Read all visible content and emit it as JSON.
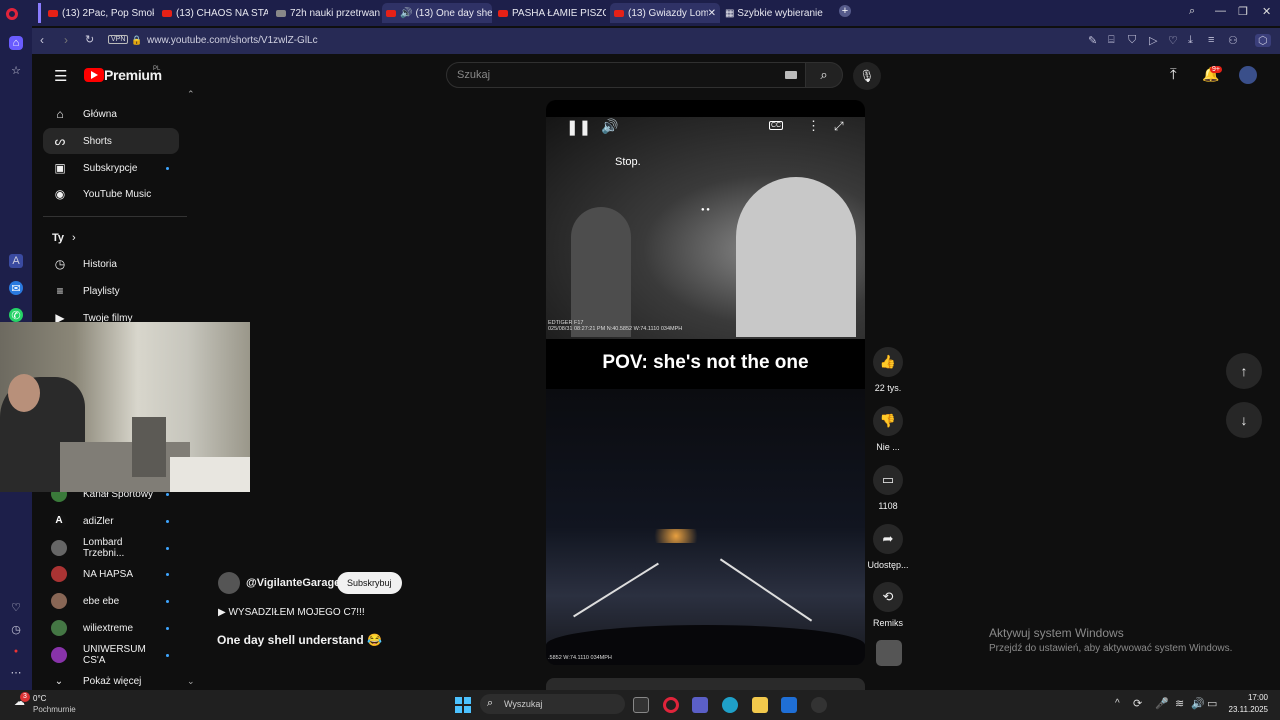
{
  "browser": {
    "tabs": [
      {
        "label": "(13) 2Pac, Pop Smoke - W",
        "active": false
      },
      {
        "label": "(13) CHAOS NA STARCIE,",
        "active": false
      },
      {
        "label": "72h nauki przetrwania - c",
        "active": false
      },
      {
        "label": "(13) One day shell und",
        "active": true
      },
      {
        "label": "PASHA ŁAMIE PISZCZEL!",
        "active": false
      },
      {
        "label": "(13) Gwiazdy Lombard",
        "active": true
      }
    ],
    "speed_dial": "Szybkie wybieranie",
    "url": "www.youtube.com/shorts/V1zwlZ-GlLc",
    "vpn": "VPN"
  },
  "youtube": {
    "logo_text": "Premium",
    "logo_sup": "PL",
    "search_placeholder": "Szukaj",
    "notif_badge": "9+",
    "nav": [
      {
        "label": "Główna",
        "icon": "home-icon"
      },
      {
        "label": "Shorts",
        "icon": "shorts-icon",
        "active": true
      },
      {
        "label": "Subskrypcje",
        "icon": "subscriptions-icon"
      },
      {
        "label": "YouTube Music",
        "icon": "music-icon"
      }
    ],
    "you_section": "Ty",
    "you_items": [
      {
        "label": "Historia"
      },
      {
        "label": "Playlisty"
      },
      {
        "label": "Twoje filmy"
      }
    ],
    "channels": [
      {
        "label": "Kanał Sportowy",
        "color": "#3a7a3a"
      },
      {
        "label": "adiZler",
        "color": "#111111"
      },
      {
        "label": "Lombard Trzebni...",
        "color": "#666666"
      },
      {
        "label": "NA HAPSA",
        "color": "#aa3333"
      },
      {
        "label": "ebe ebe",
        "color": "#886655"
      },
      {
        "label": "wiliextreme",
        "color": "#447744"
      },
      {
        "label": "UNIWERSUM CS'A",
        "color": "#8833aa"
      }
    ],
    "show_more": "Pokaż więcej",
    "short": {
      "subtitle": "Stop.",
      "dashcam_top": "EDTIGER F17\n025/08/31 08:27:21 PM N:40.5852 W:74.1110 034MPH",
      "dashcam_bottom": ".5852 W:74.1110 034MPH",
      "caption": "POV: she's not the one",
      "channel": "@VigilanteGarage",
      "subscribe": "Subskrybuj",
      "playlist": "▶ WYSADZIŁEM MOJEGO C7!!!",
      "title": "One day shell understand 😂"
    },
    "actions": [
      {
        "label": "22 tys.",
        "icon": "like-icon"
      },
      {
        "label": "Nie ...",
        "icon": "dislike-icon"
      },
      {
        "label": "1108",
        "icon": "comment-icon"
      },
      {
        "label": "Udostęp...",
        "icon": "share-icon"
      },
      {
        "label": "Remiks",
        "icon": "remix-icon"
      }
    ]
  },
  "windows_activation": {
    "title": "Aktywuj system Windows",
    "subtitle": "Przejdź do ustawień, aby aktywować system Windows."
  },
  "taskbar": {
    "weather_temp": "0°C",
    "weather_desc": "Pochmurnie",
    "weather_badge": "3",
    "search": "Wyszukaj",
    "time": "17:00",
    "date": "23.11.2025"
  }
}
